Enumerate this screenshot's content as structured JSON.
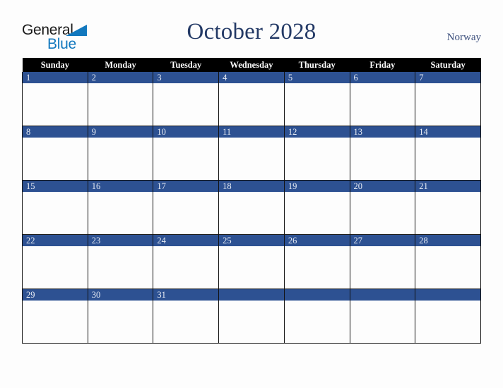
{
  "brand": {
    "name_part1": "General",
    "name_part2": "Blue",
    "triangle_color": "#1278be",
    "text_color": "#1a1a1a"
  },
  "header": {
    "title": "October 2028",
    "country": "Norway",
    "title_color": "#243a66"
  },
  "calendar": {
    "weekday_headers": [
      "Sunday",
      "Monday",
      "Tuesday",
      "Wednesday",
      "Thursday",
      "Friday",
      "Saturday"
    ],
    "header_bg": "#000000",
    "daybar_bg": "#2d5192",
    "daybar_text": "#e9edf5",
    "weeks": [
      [
        "1",
        "2",
        "3",
        "4",
        "5",
        "6",
        "7"
      ],
      [
        "8",
        "9",
        "10",
        "11",
        "12",
        "13",
        "14"
      ],
      [
        "15",
        "16",
        "17",
        "18",
        "19",
        "20",
        "21"
      ],
      [
        "22",
        "23",
        "24",
        "25",
        "26",
        "27",
        "28"
      ],
      [
        "29",
        "30",
        "31",
        "",
        "",
        "",
        ""
      ]
    ]
  }
}
